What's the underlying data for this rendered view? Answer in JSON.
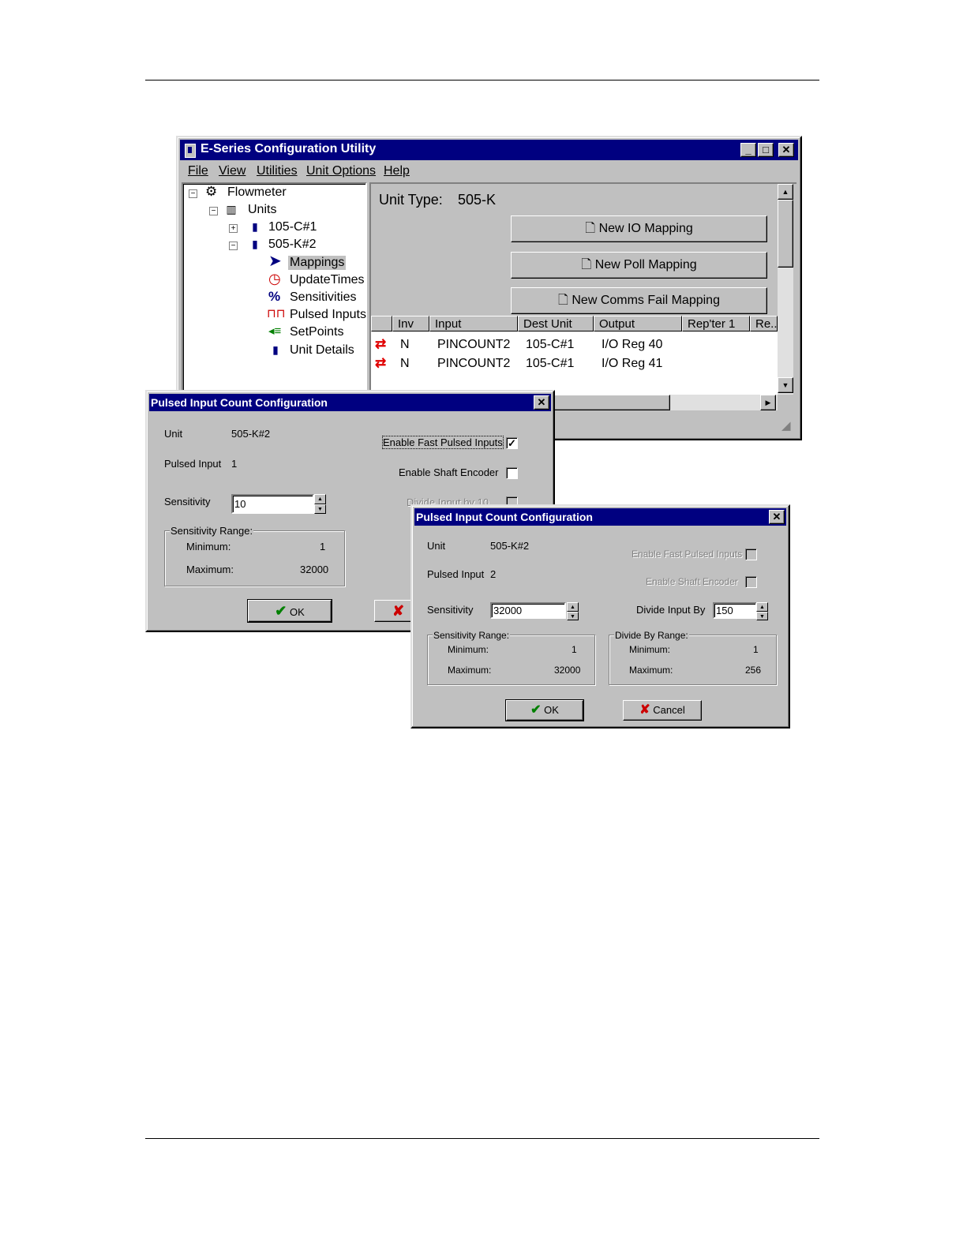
{
  "main_window": {
    "title": "E-Series Configuration Utility",
    "menu": [
      "File",
      "View",
      "Utilities",
      "Unit Options",
      "Help"
    ],
    "tree": {
      "root": "Flowmeter",
      "units": "Units",
      "unit1": "105-C#1",
      "unit2": "505-K#2",
      "children": [
        "Mappings",
        "UpdateTimes",
        "Sensitivities",
        "Pulsed Inputs",
        "SetPoints",
        "Unit Details"
      ]
    },
    "unit_type_label": "Unit Type:",
    "unit_type_value": "505-K",
    "buttons": {
      "new_io": "New IO Mapping",
      "new_poll": "New Poll Mapping",
      "new_comms_fail": "New Comms Fail Mapping"
    },
    "table": {
      "columns": [
        "Inv",
        "Input",
        "Dest Unit",
        "Output",
        "Rep'ter 1",
        "Re.."
      ],
      "rows": [
        {
          "inv": "N",
          "input": "PINCOUNT2",
          "dest": "105-C#1",
          "output": "I/O Reg 40"
        },
        {
          "inv": "N",
          "input": "PINCOUNT2",
          "dest": "105-C#1",
          "output": "I/O Reg 41"
        }
      ]
    }
  },
  "dialog1": {
    "title": "Pulsed Input Count Configuration",
    "unit_label": "Unit",
    "unit_value": "505-K#2",
    "pulsed_input_label": "Pulsed Input",
    "pulsed_input_value": "1",
    "enable_fast_label": "Enable Fast Pulsed Inputs",
    "enable_fast_checked": true,
    "enable_shaft_label": "Enable Shaft Encoder",
    "enable_shaft_checked": false,
    "divide_label": "Divide Input by 10",
    "sensitivity_label": "Sensitivity",
    "sensitivity_value": "10",
    "range_title": "Sensitivity Range:",
    "min_label": "Minimum:",
    "min_value": "1",
    "max_label": "Maximum:",
    "max_value": "32000",
    "ok": "OK"
  },
  "dialog2": {
    "title": "Pulsed Input Count Configuration",
    "unit_label": "Unit",
    "unit_value": "505-K#2",
    "pulsed_input_label": "Pulsed Input",
    "pulsed_input_value": "2",
    "enable_fast_label": "Enable Fast Pulsed Inputs",
    "enable_shaft_label": "Enable Shaft Encoder",
    "sensitivity_label": "Sensitivity",
    "sensitivity_value": "32000",
    "divide_label": "Divide Input By",
    "divide_value": "150",
    "range_title": "Sensitivity Range:",
    "min_label": "Minimum:",
    "min_value": "1",
    "max_label": "Maximum:",
    "max_value": "32000",
    "div_range_title": "Divide By Range:",
    "div_min_label": "Minimum:",
    "div_min_value": "1",
    "div_max_label": "Maximum:",
    "div_max_value": "256",
    "ok": "OK",
    "cancel": "Cancel"
  },
  "colors": {
    "titlebar": "#000080",
    "face": "#c0c0c0",
    "ok_check": "#008000",
    "cancel_x": "#cc0000",
    "mapping_arrows": "#e00000"
  }
}
